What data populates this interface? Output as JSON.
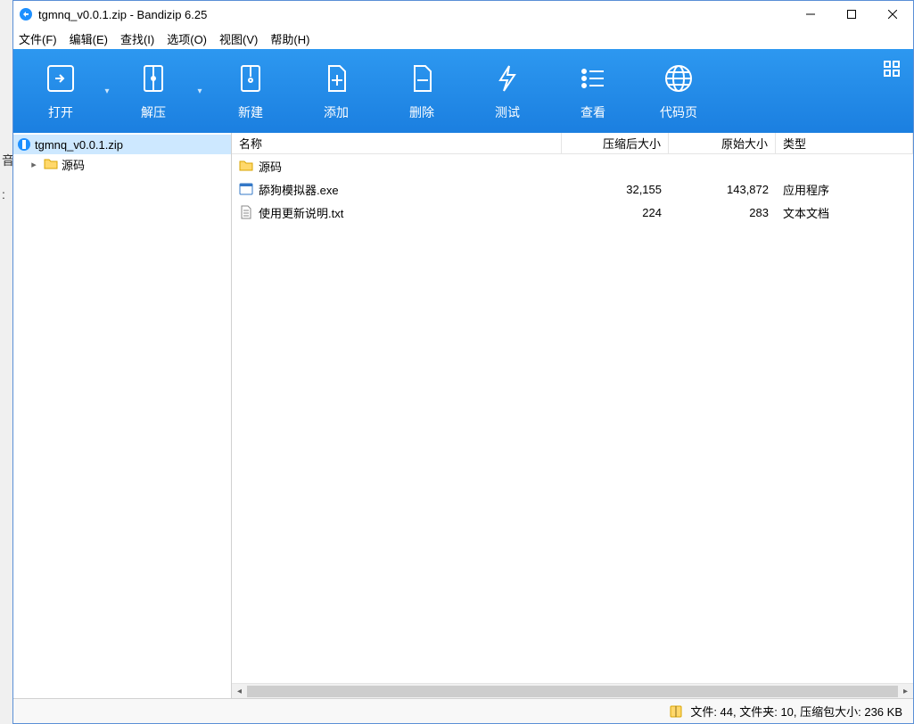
{
  "title": "tgmnq_v0.0.1.zip - Bandizip 6.25",
  "menu": {
    "file": "文件(F)",
    "edit": "编辑(E)",
    "find": "查找(I)",
    "options": "选项(O)",
    "view": "视图(V)",
    "help": "帮助(H)"
  },
  "toolbar": {
    "open": "打开",
    "extract": "解压",
    "new": "新建",
    "add": "添加",
    "delete": "删除",
    "test": "测试",
    "view": "查看",
    "codepage": "代码页"
  },
  "tree": {
    "root": "tgmnq_v0.0.1.zip",
    "child": "源码"
  },
  "columns": {
    "name": "名称",
    "compressed": "压缩后大小",
    "original": "原始大小",
    "type": "类型"
  },
  "rows": [
    {
      "name": "源码",
      "compressed": "",
      "original": "",
      "type": "",
      "icon": "folder"
    },
    {
      "name": "舔狗模拟器.exe",
      "compressed": "32,155",
      "original": "143,872",
      "type": "应用程序",
      "icon": "exe"
    },
    {
      "name": "使用更新说明.txt",
      "compressed": "224",
      "original": "283",
      "type": "文本文档",
      "icon": "txt"
    }
  ],
  "status": "文件: 44, 文件夹: 10, 压缩包大小: 236 KB"
}
